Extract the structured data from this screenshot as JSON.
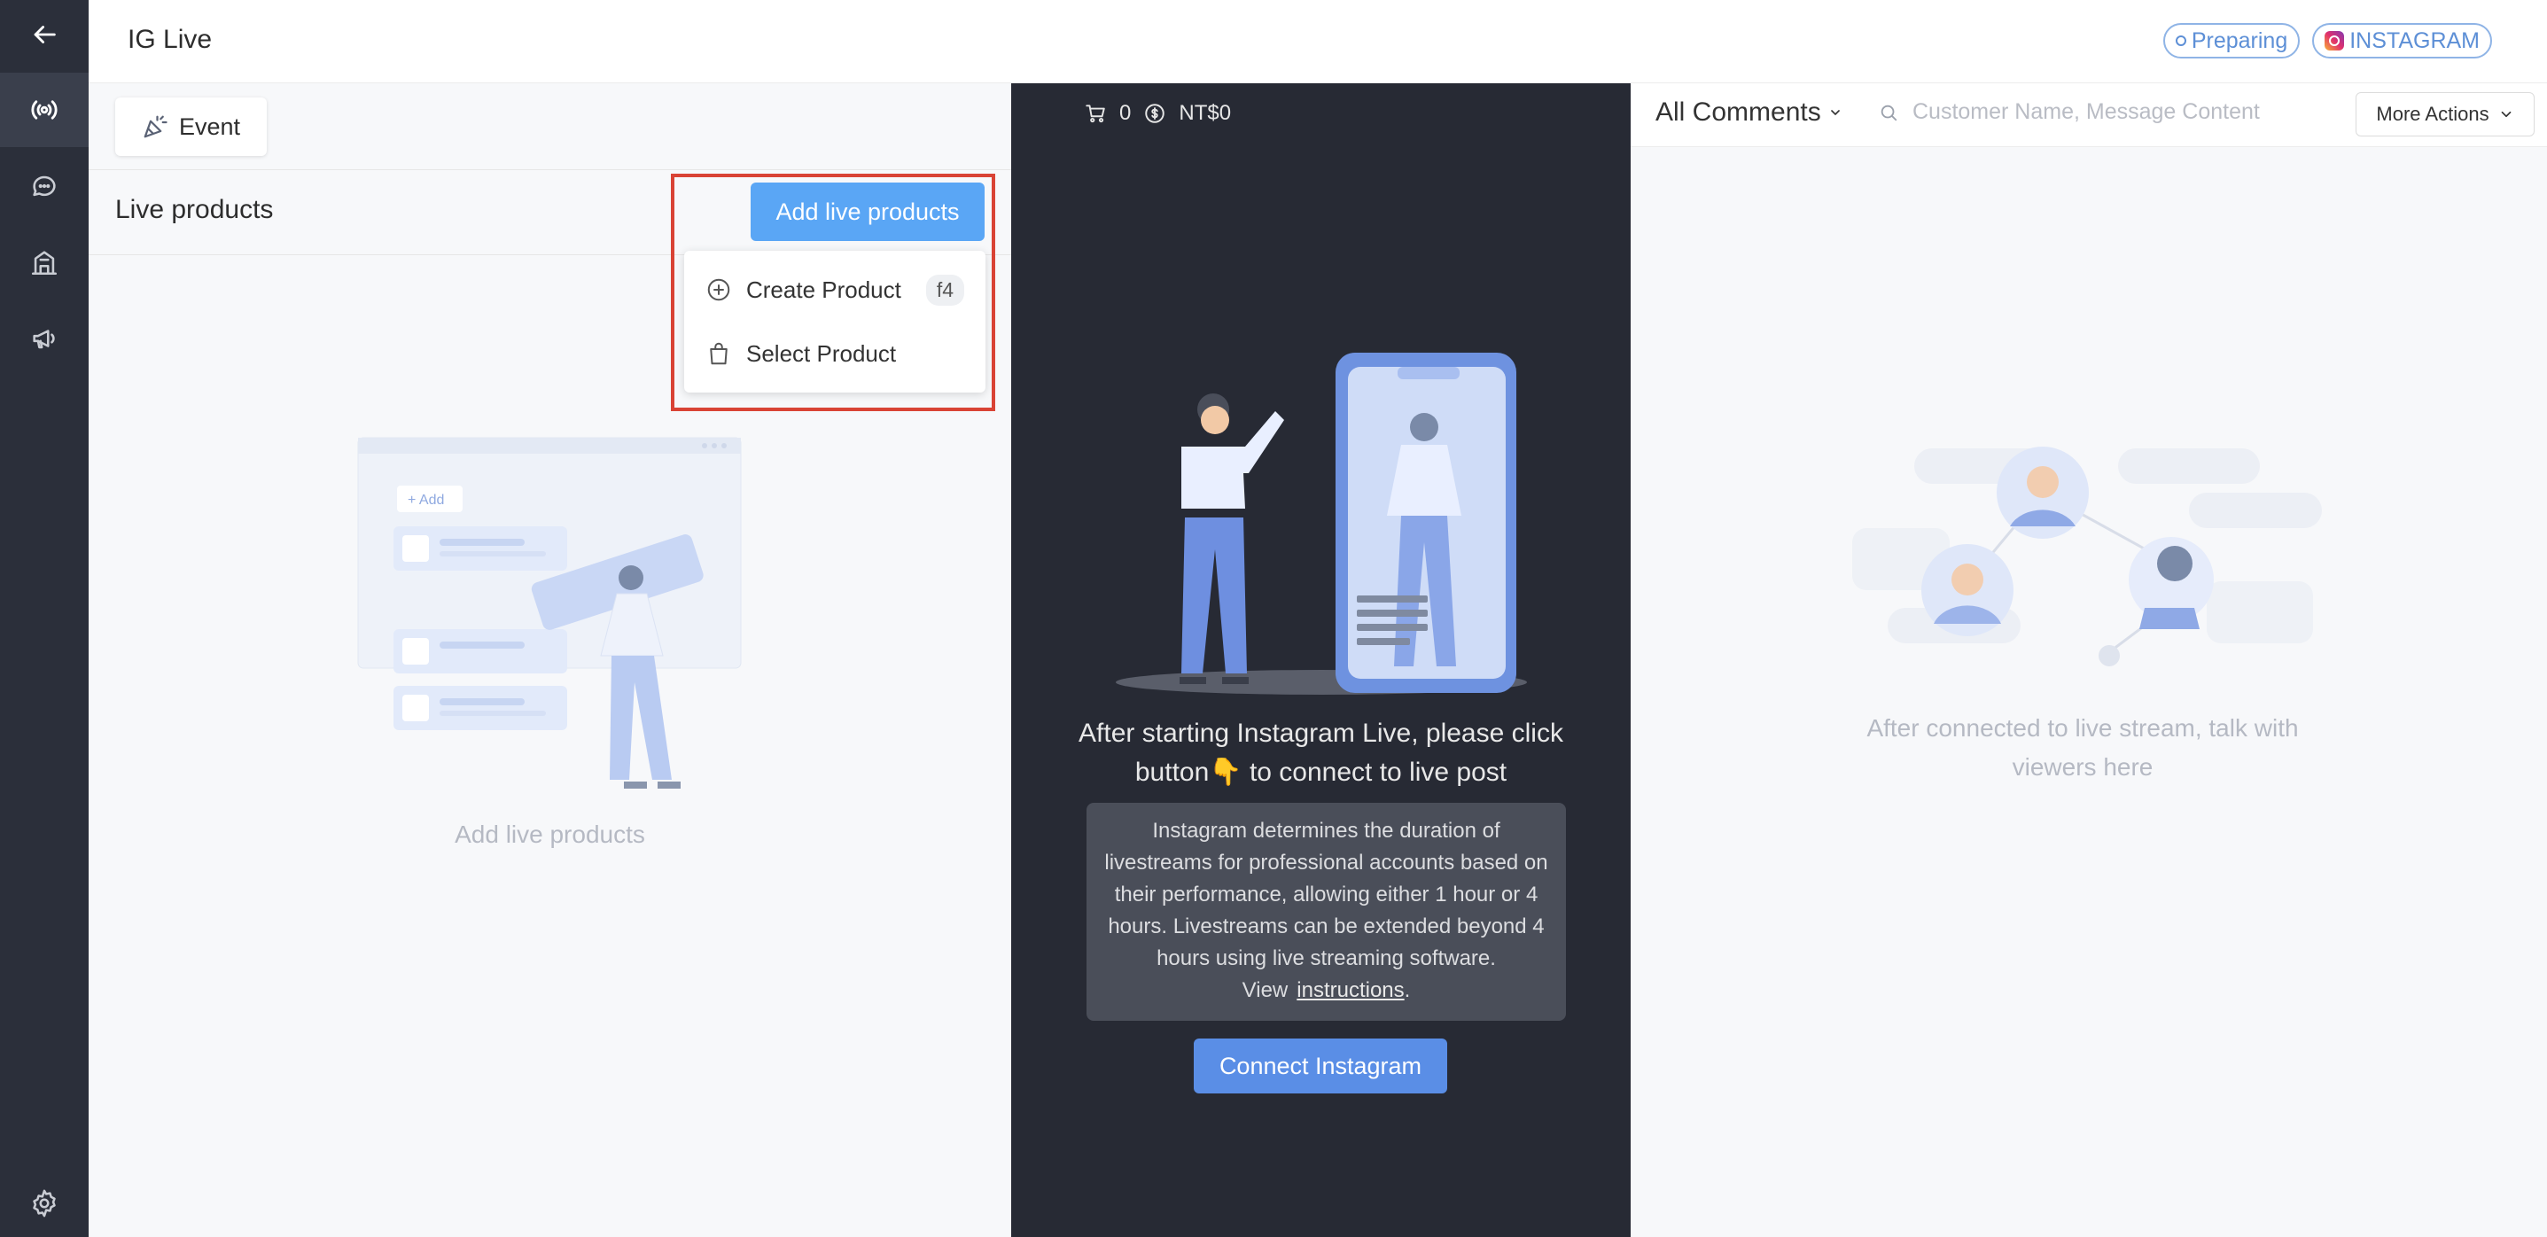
{
  "app": {
    "title": "IG Live"
  },
  "nav": {
    "items": [
      {
        "icon": "back-arrow-icon"
      },
      {
        "icon": "live-broadcast-icon"
      },
      {
        "icon": "chat-bubble-icon"
      },
      {
        "icon": "store-icon"
      },
      {
        "icon": "megaphone-icon"
      },
      {
        "icon": "gear-icon"
      }
    ]
  },
  "header": {
    "status_badge": "Preparing",
    "platform_badge": "INSTAGRAM"
  },
  "left_panel": {
    "event_button": "Event",
    "section_title": "Live products",
    "add_button": "Add live products",
    "dropdown": {
      "create_label": "Create Product",
      "create_shortcut": "f4",
      "select_label": "Select Product"
    },
    "illustration_add_label": "+ Add",
    "empty_text": "Add live products"
  },
  "center_panel": {
    "cart_count": "0",
    "total_amount": "NT$0",
    "message": "After starting Instagram Live, please click button👇 to connect to live post",
    "info_text": "Instagram determines the duration of livestreams for professional accounts based on their performance, allowing either 1 hour or 4 hours. Livestreams can be extended beyond 4 hours using live streaming software. View",
    "info_link": "instructions",
    "info_suffix": ".",
    "connect_button": "Connect Instagram"
  },
  "right_panel": {
    "filter_label": "All Comments",
    "search_placeholder": "Customer Name, Message Content",
    "more_actions": "More Actions",
    "empty_text": "After connected to live stream, talk with viewers here"
  },
  "colors": {
    "rail": "#2b2f3a",
    "accent": "#5aa6f5",
    "connect": "#5a8ee6",
    "center_bg": "#272a34",
    "highlight": "#d94335"
  }
}
